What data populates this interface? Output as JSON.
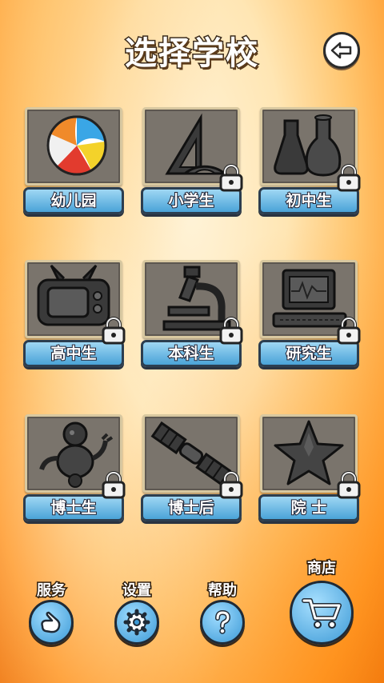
{
  "header": {
    "title": "选择学校",
    "back_icon": "back-arrow-icon"
  },
  "schools": [
    {
      "label": "幼儿园",
      "icon": "beach-ball-icon",
      "locked": false
    },
    {
      "label": "小学生",
      "icon": "triangle-ruler-icon",
      "locked": true
    },
    {
      "label": "初中生",
      "icon": "flask-icon",
      "locked": true
    },
    {
      "label": "高中生",
      "icon": "television-icon",
      "locked": true
    },
    {
      "label": "本科生",
      "icon": "microscope-icon",
      "locked": true
    },
    {
      "label": "研究生",
      "icon": "computer-icon",
      "locked": true
    },
    {
      "label": "博士生",
      "icon": "robot-icon",
      "locked": true
    },
    {
      "label": "博士后",
      "icon": "satellite-icon",
      "locked": true
    },
    {
      "label": "院 士",
      "icon": "star-icon",
      "locked": true
    }
  ],
  "bottom": {
    "service": {
      "label": "服务",
      "icon": "hand-pointer-icon"
    },
    "settings": {
      "label": "设置",
      "icon": "gear-icon"
    },
    "help": {
      "label": "帮助",
      "icon": "question-mark-icon"
    },
    "shop": {
      "label": "商店",
      "icon": "shopping-cart-icon"
    }
  },
  "colors": {
    "accent": "#4aa3d8",
    "frame": "#7a746c",
    "background": "#ffb04a"
  }
}
